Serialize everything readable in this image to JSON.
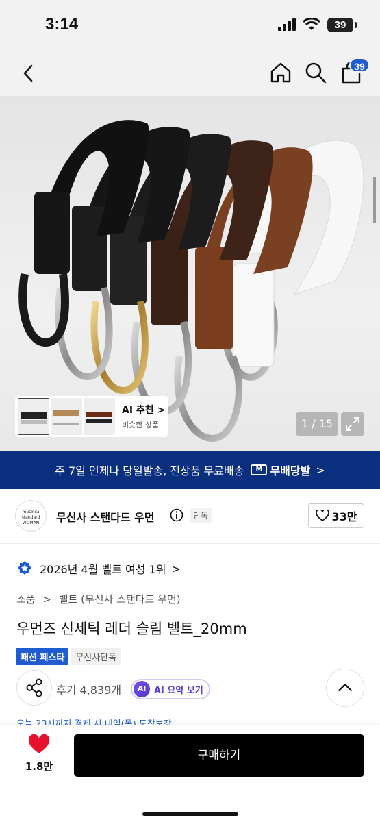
{
  "status_bar": {
    "time": "3:14",
    "battery": "39"
  },
  "nav": {
    "cart_count": "39"
  },
  "gallery": {
    "ai_rec_title": "AI 추천",
    "ai_rec_chev": ">",
    "ai_rec_sub": "비슷한 상품",
    "pager": "1 / 15"
  },
  "banner": {
    "text": "주 7일 언제나 당일발송, 전상품 무료배송",
    "logo_letter": "M",
    "brand": "무배당발",
    "chev": ">"
  },
  "brand": {
    "logo_line1": "musinsa",
    "logo_line2": "standard",
    "logo_line3": "WOMAN",
    "name": "무신사 스탠다드 우먼",
    "exclusive": "단독",
    "likes": "33만"
  },
  "ranking": {
    "text": "2026년 4월 벨트 여성 1위",
    "chev": ">"
  },
  "breadcrumb": {
    "cat": "소품",
    "sep": ">",
    "sub": "벨트 (무신사 스탠다드 우먼)"
  },
  "product": {
    "title": "우먼즈 신세틱 레더 슬림 벨트_20mm",
    "badge_fest": "패션 페스타",
    "badge_excl": "무신사단독",
    "reviews": "후기 4,839개",
    "ai_label": "AI",
    "ai_summary": "AI 요약 보기",
    "delivery_peek": "오늘 23시까지 결제 시 내일(목) 도착보장"
  },
  "bottom": {
    "like_count": "1.8만",
    "buy_label": "구매하기"
  },
  "colors": {
    "accent": "#1f5ccf",
    "banner_bg": "#0a2f7e",
    "heart": "#e8112d"
  }
}
